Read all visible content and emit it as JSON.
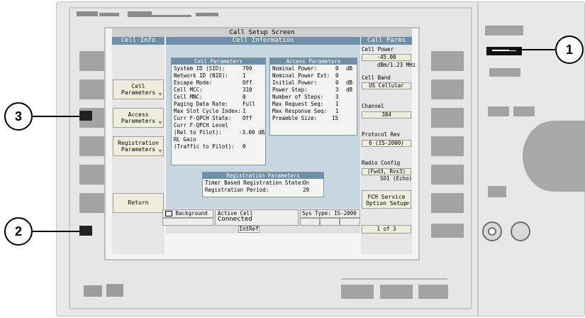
{
  "screen": {
    "title": "Call Setup Screen",
    "tabs": {
      "left": "Cell Info",
      "center": "Cell Information",
      "right": "Call Parms"
    }
  },
  "left_menu": [
    {
      "label": "Cell Parameters",
      "has_arrow": true
    },
    {
      "label": "Access Parameters",
      "has_arrow": true
    },
    {
      "label": "Registration Parameters",
      "has_arrow": true
    },
    {
      "label": "Return",
      "has_arrow": false
    }
  ],
  "cell_parameters": {
    "title": "Cell Parameters",
    "rows": [
      {
        "label": "System ID (SID):",
        "value": "799"
      },
      {
        "label": "Network ID (NID):",
        "value": "1"
      },
      {
        "label": "Escape Mode:",
        "value": "Off"
      },
      {
        "label": "Cell MCC:",
        "value": "310"
      },
      {
        "label": "Cell MNC:",
        "value": "0"
      },
      {
        "label": "Paging Data Rate:",
        "value": "Full"
      },
      {
        "label": "Max Slot Cycle Index:",
        "value": "1"
      },
      {
        "label": "Curr F-QPCH State:",
        "value": "Off"
      },
      {
        "label": "Curr F-QPCH Level",
        "value": ""
      },
      {
        "label": "  (Rel to Pilot):",
        "value": "-3.00 dB"
      },
      {
        "label": "RL Gain",
        "value": ""
      },
      {
        "label": "  (Traffic to Pilot):",
        "value": "0"
      }
    ]
  },
  "access_parameters": {
    "title": "Access Parameters",
    "rows": [
      {
        "label": "Nominal Power:",
        "value": "0",
        "unit": "dB"
      },
      {
        "label": "Nominal Power Ext:",
        "value": "0",
        "unit": ""
      },
      {
        "label": "Initial Power:",
        "value": "0",
        "unit": "dB"
      },
      {
        "label": "Power Step:",
        "value": "3",
        "unit": "dB"
      },
      {
        "label": "Number of Steps:",
        "value": "3",
        "unit": ""
      },
      {
        "label": "Max Request Seq:",
        "value": "1",
        "unit": ""
      },
      {
        "label": "Max Response Seq:",
        "value": "1",
        "unit": ""
      },
      {
        "label": "Preamble Size:",
        "value": "15",
        "unit": ""
      }
    ]
  },
  "registration_parameters": {
    "title": "Registration Parameters",
    "rows": [
      {
        "label": "Timer Based Registration State:",
        "value": "On"
      },
      {
        "label": "Registration Period:",
        "value": "29"
      }
    ]
  },
  "call_parms": {
    "cell_power_label": "Cell Power",
    "cell_power_value": "-45.00",
    "cell_power_unit": "dBm/1.23 MHz",
    "cell_band_label": "Cell Band",
    "cell_band_value": "US Cellular",
    "channel_label": "Channel",
    "channel_value": "384",
    "protocol_rev_label": "Protocol Rev",
    "protocol_rev_value": "6 (IS-2000)",
    "radio_config_label": "Radio Config",
    "radio_config_value": "(Fwd3, Rvs3)",
    "so_value": "SO1 (Echo)",
    "fch_button": "FCH Service Option Setup",
    "page_indicator": "1 of 3"
  },
  "status_bar": {
    "background_label": "Background",
    "active_cell_label": "Active Cell",
    "active_cell_value": "Connected",
    "sys_type": "Sys Type: IS-2000",
    "int_ref": "IntRef"
  },
  "callouts": [
    "1",
    "2",
    "3"
  ]
}
